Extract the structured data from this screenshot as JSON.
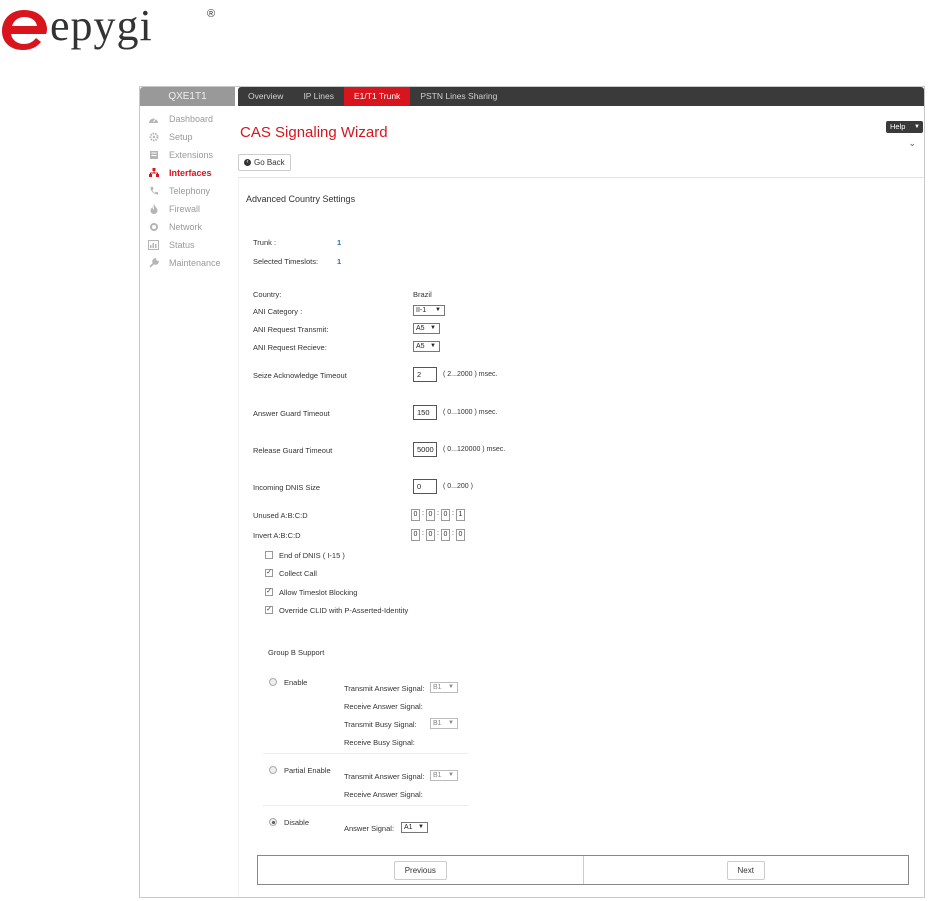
{
  "brand": {
    "name": "epygi",
    "reg": "®",
    "color": "#d8141c"
  },
  "sidebar": {
    "device": "QXE1T1",
    "items": [
      {
        "label": "Dashboard",
        "icon": "dashboard-icon"
      },
      {
        "label": "Setup",
        "icon": "gear-icon"
      },
      {
        "label": "Extensions",
        "icon": "extensions-icon"
      },
      {
        "label": "Interfaces",
        "icon": "interfaces-icon",
        "active": true
      },
      {
        "label": "Telephony",
        "icon": "phone-icon"
      },
      {
        "label": "Firewall",
        "icon": "fire-icon"
      },
      {
        "label": "Network",
        "icon": "network-icon"
      },
      {
        "label": "Status",
        "icon": "status-icon"
      },
      {
        "label": "Maintenance",
        "icon": "wrench-icon"
      }
    ]
  },
  "tabs": [
    {
      "label": "Overview"
    },
    {
      "label": "IP Lines"
    },
    {
      "label": "E1/T1 Trunk",
      "active": true
    },
    {
      "label": "PSTN Lines Sharing"
    }
  ],
  "header": {
    "title": "CAS Signaling Wizard",
    "help": "Help",
    "go_back": "Go Back"
  },
  "form": {
    "section": "Advanced Country Settings",
    "trunk_label": "Trunk :",
    "trunk_value": "1",
    "timeslots_label": "Selected Timeslots:",
    "timeslots_value": "1",
    "country_label": "Country:",
    "country_value": "Brazil",
    "ani_category_label": "ANI Category :",
    "ani_category_value": "II-1",
    "ani_transmit_label": "ANI Request Transmit:",
    "ani_transmit_value": "A5",
    "ani_receive_label": "ANI Request Recieve:",
    "ani_receive_value": "A5",
    "seize_label": "Seize Acknowledge Timeout",
    "seize_value": "2",
    "seize_unit": "( 2...2000 ) msec.",
    "answer_guard_label": "Answer Guard Timeout",
    "answer_guard_value": "150",
    "answer_guard_unit": "( 0...1000 ) msec.",
    "release_guard_label": "Release Guard Timeout",
    "release_guard_value": "5000",
    "release_guard_unit": "( 0...120000 ) msec.",
    "dnis_label": "Incoming DNIS Size",
    "dnis_value": "0",
    "dnis_unit": "( 0...200 )",
    "unused_label": "Unused A:B:C:D",
    "unused_values": [
      "0",
      "0",
      "0",
      "1"
    ],
    "invert_label": "Invert A:B:C:D",
    "invert_values": [
      "0",
      "0",
      "0",
      "0"
    ],
    "checkboxes": [
      {
        "label": "End of DNIS ( I-15 )",
        "checked": false
      },
      {
        "label": "Collect Call",
        "checked": true
      },
      {
        "label": "Allow Timeslot Blocking",
        "checked": true
      },
      {
        "label": "Override CLID with P-Asserted-Identity",
        "checked": true
      }
    ],
    "group_b_label": "Group B Support",
    "enable_label": "Enable",
    "partial_label": "Partial Enable",
    "disable_label": "Disable",
    "transmit_answer_label": "Transmit Answer Signal:",
    "receive_answer_label": "Receive Answer Signal:",
    "transmit_busy_label": "Transmit Busy Signal:",
    "receive_busy_label": "Receive Busy Signal:",
    "answer_signal_label": "Answer Signal:",
    "b1": "B1",
    "answer_signal_value": "A1",
    "selected_group_b": "Disable"
  },
  "footer": {
    "previous": "Previous",
    "next": "Next"
  }
}
